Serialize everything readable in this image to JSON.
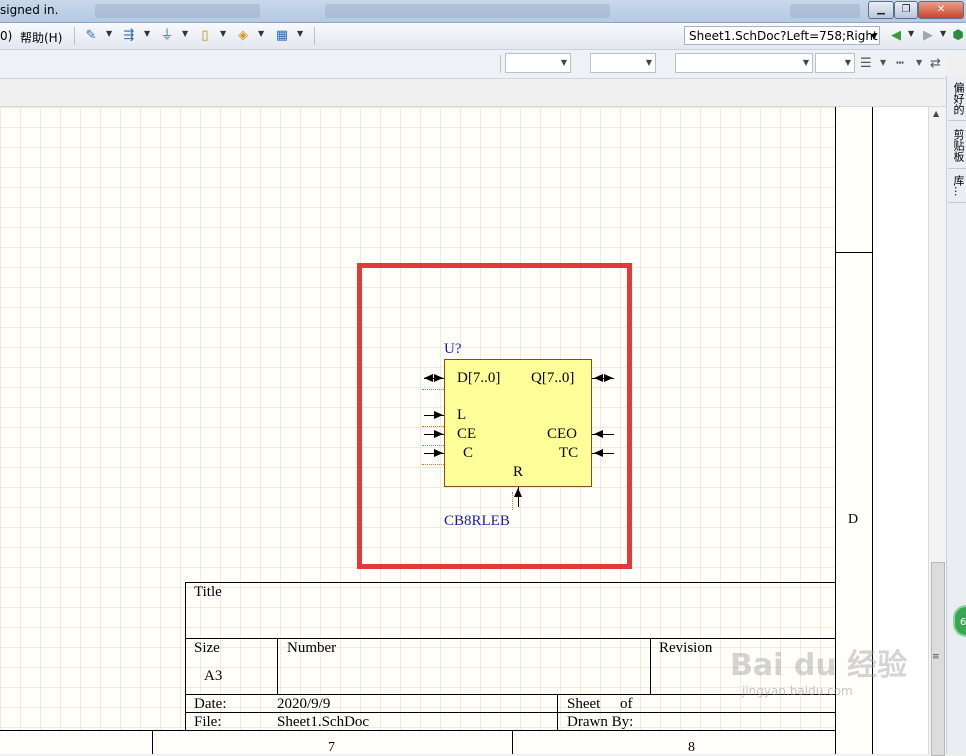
{
  "window": {
    "title_fragment": "signed in.",
    "buttons": {
      "minimize": "▁",
      "maximize": "❐",
      "close": "✕"
    }
  },
  "menu": {
    "help": "帮助(H)",
    "prev_fragment": "0)"
  },
  "address_bar": {
    "value": "Sheet1.SchDoc?Left=758;Right="
  },
  "right_panel": {
    "tabs": [
      "偏好的",
      "剪贴板",
      "库..."
    ]
  },
  "component": {
    "designator": "U?",
    "comment": "CB8RLEB",
    "pins_left": [
      "D[7..0]",
      "L",
      "CE",
      "C"
    ],
    "pins_right": [
      "Q[7..0]",
      "CEO",
      "TC"
    ],
    "pin_bottom": "R",
    "body_color": "#ffff99",
    "selection_color": "#e53838"
  },
  "title_block": {
    "title_label": "Title",
    "size_label": "Size",
    "size_value": "A3",
    "number_label": "Number",
    "revision_label": "Revision",
    "date_label": "Date:",
    "date_value": "2020/9/9",
    "file_label": "File:",
    "file_value": "Sheet1.SchDoc",
    "sheet_label": "Sheet",
    "of_label": "of",
    "drawn_by_label": "Drawn By:"
  },
  "sheet_border": {
    "zone_row": "D",
    "zone_cols": [
      "7",
      "8"
    ]
  },
  "overlays": {
    "badge": "6",
    "watermark": "Bai du 经验",
    "watermark_url": "jingyan.baidu.com"
  }
}
